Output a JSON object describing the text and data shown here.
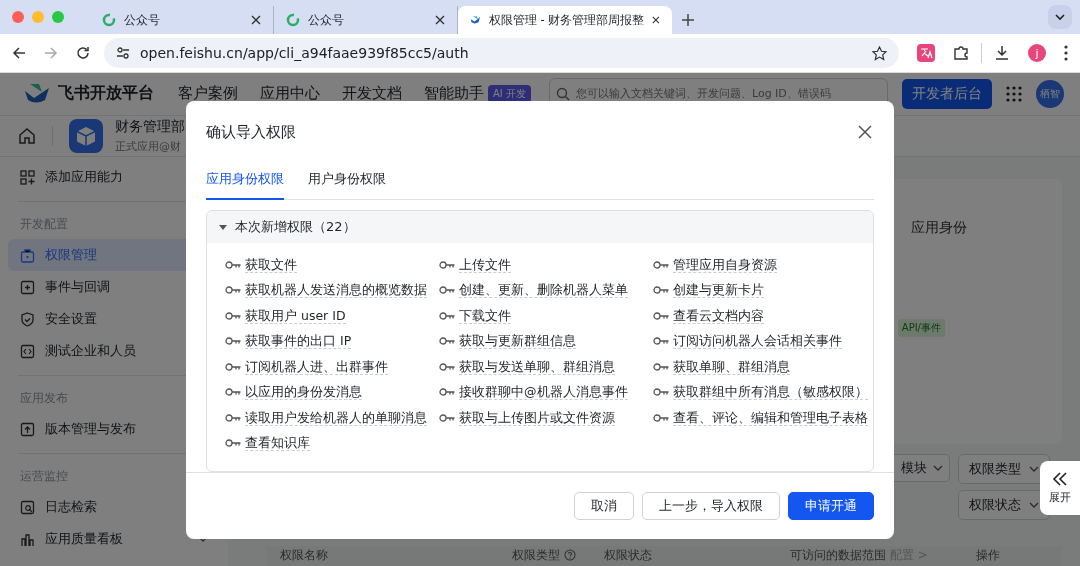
{
  "browser": {
    "tabs": [
      {
        "title": "公众号",
        "kind": "ring",
        "selected": false
      },
      {
        "title": "公众号",
        "kind": "ring",
        "selected": false
      },
      {
        "title": "权限管理 - 财务管理部周报整",
        "kind": "bird",
        "selected": true
      }
    ],
    "url": "open.feishu.cn/app/cli_a94faae939f85cc5/auth",
    "profile": "j"
  },
  "header": {
    "brand": "飞书开放平台",
    "nav": [
      {
        "label": "客户案例"
      },
      {
        "label": "应用中心"
      },
      {
        "label": "开发文档"
      },
      {
        "label": "智能助手",
        "badge": "AI 开发"
      }
    ],
    "search": {
      "placeholder": "您可以输入文档关键词、开发问题、Log ID、错误码"
    },
    "console_button": "开发者后台",
    "avatar": "栖智"
  },
  "app": {
    "name": "财务管理部",
    "subtitle": "正式应用@财"
  },
  "sidebar": {
    "items": [
      {
        "kind": "item",
        "label": "添加应用能力",
        "selected": false
      },
      {
        "kind": "section",
        "label": "开发配置"
      },
      {
        "kind": "item",
        "label": "权限管理",
        "selected": true
      },
      {
        "kind": "item",
        "label": "事件与回调",
        "selected": false
      },
      {
        "kind": "item",
        "label": "安全设置",
        "selected": false
      },
      {
        "kind": "item",
        "label": "测试企业和人员",
        "selected": false
      },
      {
        "kind": "section",
        "label": "应用发布"
      },
      {
        "kind": "item",
        "label": "版本管理与发布",
        "selected": false
      },
      {
        "kind": "section",
        "label": "运营监控"
      },
      {
        "kind": "item",
        "label": "日志检索",
        "selected": false
      },
      {
        "kind": "item",
        "label": "应用质量看板",
        "selected": false,
        "expandable": true
      }
    ]
  },
  "main": {
    "description": "应用身份",
    "tag": "API/事件",
    "filters": [
      {
        "label": "模块"
      },
      {
        "label": "权限类型"
      },
      {
        "label": "权限状态"
      }
    ],
    "table": {
      "columns": [
        {
          "label": "权限名称"
        },
        {
          "label": "权限类型",
          "help": true
        },
        {
          "label": "权限状态"
        },
        {
          "label": "可访问的数据范围",
          "link": "配置 >"
        },
        {
          "label": "操作"
        }
      ]
    },
    "expand_button": "展开"
  },
  "dialog": {
    "title": "确认导入权限",
    "tabs": [
      {
        "label": "应用身份权限",
        "selected": true
      },
      {
        "label": "用户身份权限",
        "selected": false
      }
    ],
    "section": {
      "title": "本次新增权限（22）",
      "expanded": true,
      "permissions": [
        "获取文件",
        "上传文件",
        "管理应用自身资源",
        "获取机器人发送消息的概览数据",
        "创建、更新、删除机器人菜单",
        "创建与更新卡片",
        "获取用户 user ID",
        "下载文件",
        "查看云文档内容",
        "获取事件的出口 IP",
        "获取与更新群组信息",
        "订阅访问机器人会话相关事件",
        "订阅机器人进、出群事件",
        "获取与发送单聊、群组消息",
        "获取单聊、群组消息",
        "以应用的身份发消息",
        "接收群聊中@机器人消息事件",
        "获取群组中所有消息（敏感权限）",
        "读取用户发给机器人的单聊消息",
        "获取与上传图片或文件资源",
        "查看、评论、编辑和管理电子表格",
        "查看知识库"
      ]
    },
    "buttons": [
      {
        "label": "取消",
        "kind": "default"
      },
      {
        "label": "上一步，导入权限",
        "kind": "default"
      },
      {
        "label": "申请开通",
        "kind": "primary"
      }
    ]
  }
}
